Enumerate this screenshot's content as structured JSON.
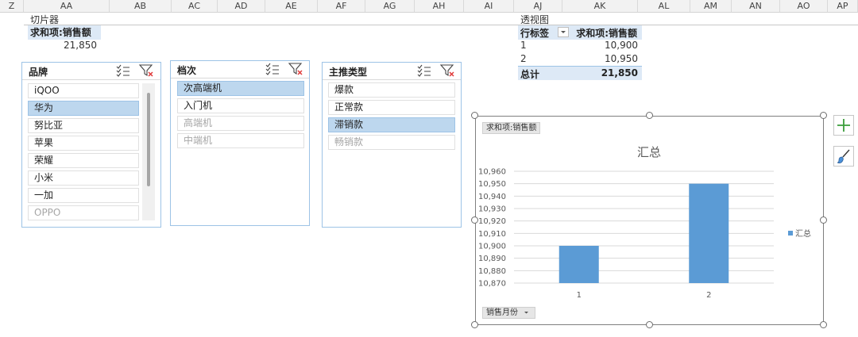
{
  "columns": [
    "Z",
    "AA",
    "AB",
    "AC",
    "AD",
    "AE",
    "AF",
    "AG",
    "AH",
    "AI",
    "AJ",
    "AK",
    "AL",
    "AM",
    "AN",
    "AO",
    "AP"
  ],
  "slicer_area": {
    "label": "切片器",
    "sum_header": "求和项:销售额",
    "sum_value": "21,850"
  },
  "pivot": {
    "label": "透视图",
    "row_label_header": "行标签",
    "value_header": "求和项:销售额",
    "rows": [
      {
        "label": "1",
        "value": "10,900"
      },
      {
        "label": "2",
        "value": "10,950"
      }
    ],
    "total_label": "总计",
    "total_value": "21,850"
  },
  "slicers": [
    {
      "title": "品牌",
      "items": [
        {
          "label": "iQOO",
          "state": "normal"
        },
        {
          "label": "华为",
          "state": "selected"
        },
        {
          "label": "努比亚",
          "state": "normal"
        },
        {
          "label": "苹果",
          "state": "normal"
        },
        {
          "label": "荣耀",
          "state": "normal"
        },
        {
          "label": "小米",
          "state": "normal"
        },
        {
          "label": "一加",
          "state": "normal"
        },
        {
          "label": "OPPO",
          "state": "dim"
        }
      ]
    },
    {
      "title": "档次",
      "items": [
        {
          "label": "次高端机",
          "state": "selected"
        },
        {
          "label": "入门机",
          "state": "normal"
        },
        {
          "label": "高端机",
          "state": "dim"
        },
        {
          "label": "中端机",
          "state": "dim"
        }
      ]
    },
    {
      "title": "主推类型",
      "items": [
        {
          "label": "爆款",
          "state": "normal"
        },
        {
          "label": "正常款",
          "state": "normal"
        },
        {
          "label": "滞销款",
          "state": "selected"
        },
        {
          "label": "畅销款",
          "state": "dim"
        }
      ]
    }
  ],
  "chart": {
    "value_field_button": "求和项:销售额",
    "axis_field_button": "销售月份",
    "icons": {
      "multi_select": "multi-select-icon",
      "clear_filter": "clear-filter-icon",
      "add": "plus-icon",
      "style": "brush-icon"
    }
  },
  "chart_data": {
    "type": "bar",
    "title": "汇总",
    "categories": [
      "1",
      "2"
    ],
    "series": [
      {
        "name": "汇总",
        "values": [
          10900,
          10950
        ]
      }
    ],
    "ylim": [
      10870,
      10960
    ],
    "yticks": [
      10870,
      10880,
      10890,
      10900,
      10910,
      10920,
      10930,
      10940,
      10950,
      10960
    ],
    "ytick_labels": [
      "10,870",
      "10,880",
      "10,890",
      "10,900",
      "10,910",
      "10,920",
      "10,930",
      "10,940",
      "10,950",
      "10,960"
    ],
    "color": "#5b9bd5",
    "legend": "right",
    "grid": true
  }
}
